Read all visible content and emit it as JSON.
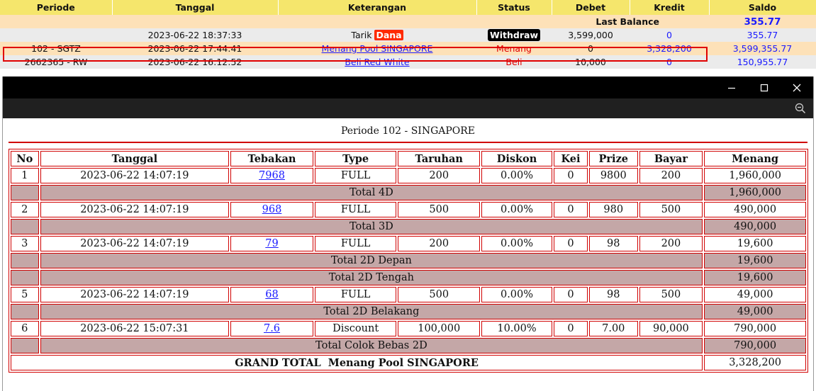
{
  "ledger": {
    "headers": [
      "Periode",
      "Tanggal",
      "Keterangan",
      "Status",
      "Debet",
      "Kredit",
      "Saldo"
    ],
    "last_balance_label": "Last Balance",
    "last_balance_value": "355.77",
    "rows": [
      {
        "periode": "",
        "tanggal": "2023-06-22 18:37:33",
        "ket_text": "Tarik",
        "ket_badge": "Dana",
        "status": "Withdraw",
        "debet": "3,599,000",
        "kredit": "0",
        "saldo": "355.77"
      },
      {
        "periode": "102 - SGTZ",
        "tanggal": "2023-06-22 17:44:41",
        "ket_link": "Menang Pool SINGAPORE",
        "status": "Menang",
        "debet": "0",
        "kredit": "3,328,200",
        "saldo": "3,599,355.77"
      },
      {
        "periode": "2662365 - RW",
        "tanggal": "2023-06-22 16:12:52",
        "ket_link": "Beli Red White",
        "status": "Beli",
        "debet": "10,000",
        "kredit": "0",
        "saldo": "150,955.77"
      }
    ]
  },
  "popup": {
    "title": "Periode 102 - SINGAPORE",
    "headers": [
      "No",
      "Tanggal",
      "Tebakan",
      "Type",
      "Taruhan",
      "Diskon",
      "Kei",
      "Prize",
      "Bayar",
      "Menang"
    ],
    "rows": [
      {
        "kind": "bet",
        "no": "1",
        "tanggal": "2023-06-22 14:07:19",
        "tebakan": "7968",
        "type": "FULL",
        "taruhan": "200",
        "diskon": "0.00%",
        "kei": "0",
        "prize": "9800",
        "bayar": "200",
        "menang": "1,960,000"
      },
      {
        "kind": "total",
        "label": "Total 4D",
        "menang": "1,960,000"
      },
      {
        "kind": "bet",
        "no": "2",
        "tanggal": "2023-06-22 14:07:19",
        "tebakan": "968",
        "type": "FULL",
        "taruhan": "500",
        "diskon": "0.00%",
        "kei": "0",
        "prize": "980",
        "bayar": "500",
        "menang": "490,000"
      },
      {
        "kind": "total",
        "label": "Total 3D",
        "menang": "490,000"
      },
      {
        "kind": "bet",
        "no": "3",
        "tanggal": "2023-06-22 14:07:19",
        "tebakan": "79",
        "type": "FULL",
        "taruhan": "200",
        "diskon": "0.00%",
        "kei": "0",
        "prize": "98",
        "bayar": "200",
        "menang": "19,600"
      },
      {
        "kind": "total",
        "label": "Total 2D Depan",
        "menang": "19,600"
      },
      {
        "kind": "total",
        "label": "Total 2D Tengah",
        "menang": "19,600"
      },
      {
        "kind": "bet",
        "no": "5",
        "tanggal": "2023-06-22 14:07:19",
        "tebakan": "68",
        "type": "FULL",
        "taruhan": "500",
        "diskon": "0.00%",
        "kei": "0",
        "prize": "98",
        "bayar": "500",
        "menang": "49,000"
      },
      {
        "kind": "total",
        "label": "Total 2D Belakang",
        "menang": "49,000"
      },
      {
        "kind": "bet",
        "no": "6",
        "tanggal": "2023-06-22 15:07:31",
        "tebakan": "7.6",
        "type": "Discount",
        "taruhan": "100,000",
        "diskon": "10.00%",
        "kei": "0",
        "prize": "7.00",
        "bayar": "90,000",
        "menang": "790,000"
      },
      {
        "kind": "total",
        "label": "Total Colok Bebas 2D",
        "menang": "790,000"
      },
      {
        "kind": "grand",
        "label": "GRAND TOTAL  Menang Pool SINGAPORE",
        "menang": "3,328,200"
      }
    ]
  },
  "icons": {
    "minimize": "minimize-icon",
    "maximize": "maximize-icon",
    "close": "close-icon",
    "zoom_out": "zoom-out-icon"
  },
  "colors": {
    "header_yellow": "#f5e66c",
    "highlight_peach": "#fde1b8",
    "row_gray": "#ebebeb",
    "link_blue": "#1a1aff",
    "status_red": "#e00000",
    "total_row_bg": "#c4a7a7"
  }
}
